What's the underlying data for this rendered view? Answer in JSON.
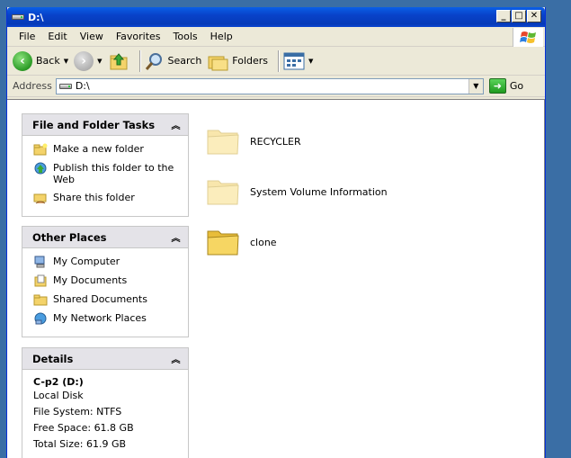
{
  "window": {
    "title": "D:\\",
    "min_label": "_",
    "max_label": "□",
    "close_label": "✕"
  },
  "menu": [
    "File",
    "Edit",
    "View",
    "Favorites",
    "Tools",
    "Help"
  ],
  "toolbar": {
    "back_label": "Back",
    "search_label": "Search",
    "folders_label": "Folders"
  },
  "address": {
    "label": "Address",
    "value": "D:\\",
    "go_label": "Go"
  },
  "tasks_panel": {
    "title": "File and Folder Tasks",
    "items": [
      {
        "label": "Make a new folder",
        "icon": "new-folder-icon"
      },
      {
        "label": "Publish this folder to the Web",
        "icon": "publish-web-icon"
      },
      {
        "label": "Share this folder",
        "icon": "share-folder-icon"
      }
    ]
  },
  "places_panel": {
    "title": "Other Places",
    "items": [
      {
        "label": "My Computer",
        "icon": "my-computer-icon"
      },
      {
        "label": "My Documents",
        "icon": "my-documents-icon"
      },
      {
        "label": "Shared Documents",
        "icon": "shared-documents-icon"
      },
      {
        "label": "My Network Places",
        "icon": "network-places-icon"
      }
    ]
  },
  "details_panel": {
    "title": "Details",
    "name": "C-p2 (D:)",
    "type": "Local Disk",
    "file_system": "File System: NTFS",
    "free_space": "Free Space: 61.8 GB",
    "total_size": "Total Size: 61.9 GB"
  },
  "files": [
    {
      "name": "RECYCLER",
      "hidden": true
    },
    {
      "name": "System Volume Information",
      "hidden": true
    },
    {
      "name": "clone",
      "hidden": false
    }
  ],
  "colors": {
    "titlebar": "#0842c9",
    "desktop": "#3a6ea5",
    "window_bg": "#ece9d8",
    "folder": "#f4d36a"
  }
}
